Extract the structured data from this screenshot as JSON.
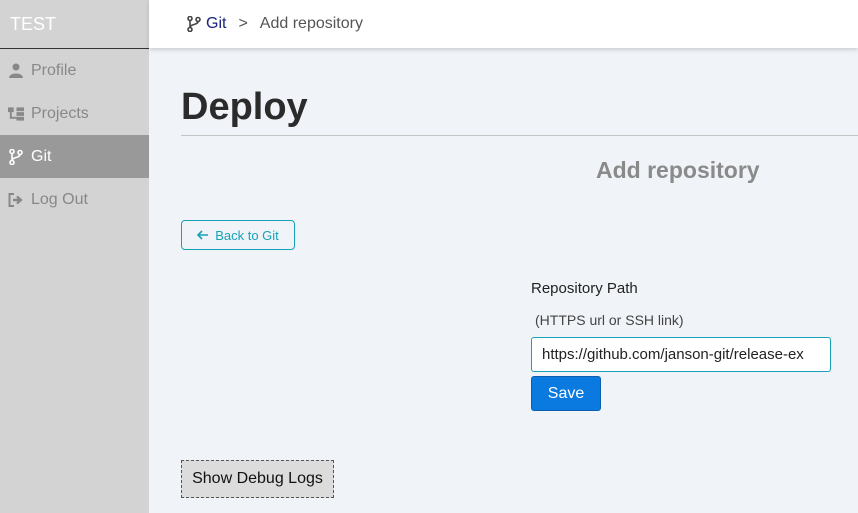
{
  "sidebar": {
    "brand": "TEST",
    "items": [
      {
        "label": "Profile",
        "icon": "user-icon"
      },
      {
        "label": "Projects",
        "icon": "project-tree-icon"
      },
      {
        "label": "Git",
        "icon": "git-branch-icon",
        "active": true
      },
      {
        "label": "Log Out",
        "icon": "logout-icon"
      }
    ]
  },
  "header": {
    "breadcrumb": {
      "link_label": "Git",
      "separator": ">",
      "current": "Add repository"
    }
  },
  "main": {
    "title": "Deploy",
    "section_title": "Add repository",
    "back_button_label": "Back to Git",
    "form": {
      "label": "Repository Path",
      "hint": "(HTTPS url or SSH link)",
      "path_value": "https://github.com/janson-git/release-ex",
      "save_label": "Save"
    },
    "debug_button_label": "Show Debug Logs"
  },
  "colors": {
    "sidebar_bg": "#d3d3d3",
    "sidebar_active_bg": "#999999",
    "accent_teal": "#17a2b8",
    "primary_blue": "#0a7ae0",
    "page_bg": "#f0f3f8"
  }
}
